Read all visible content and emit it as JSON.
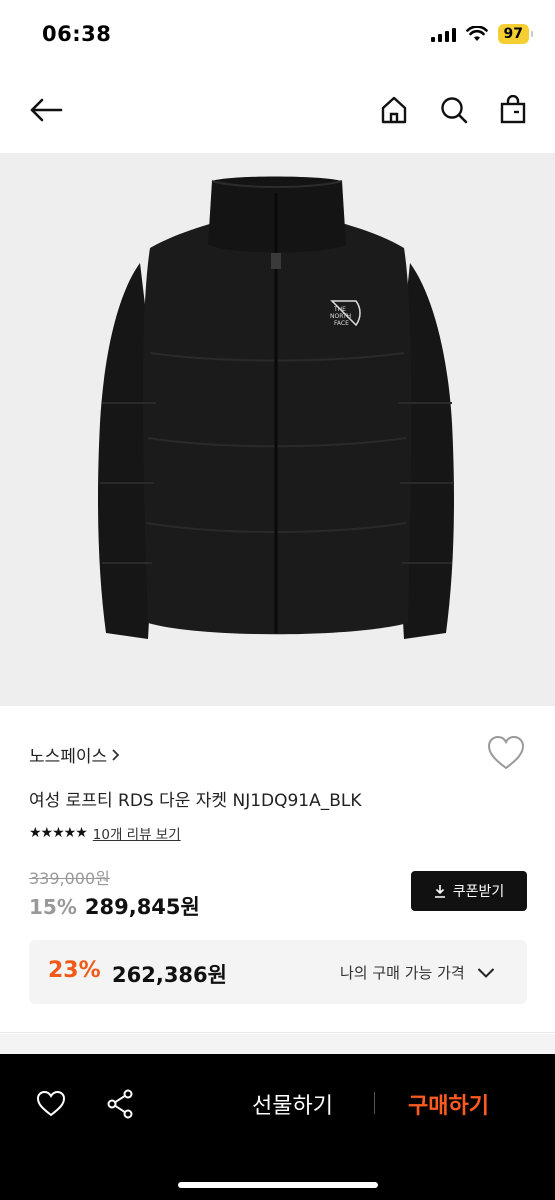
{
  "status_bar": {
    "time": "06:38",
    "battery": "97"
  },
  "header": {
    "back_icon": "arrow-left-icon",
    "home_icon": "home-icon",
    "search_icon": "search-icon",
    "cart_icon": "shopping-bag-icon"
  },
  "product": {
    "brand": "노스페이스",
    "name": "여성 로프티 RDS 다운 자켓 NJ1DQ91A_BLK",
    "rating_stars": "★★★★★",
    "review_link": "10개 리뷰 보기",
    "original_price": "339,000원",
    "discount_rate": "15%",
    "sale_price": "289,845원",
    "coupon_button": "쿠폰받기",
    "my_discount_rate": "23%",
    "my_price": "262,386원",
    "my_price_label": "나의 구매 가능 가격",
    "logo_text": "THE NORTH FACE"
  },
  "bottom_bar": {
    "gift_label": "선물하기",
    "buy_label": "구매하기"
  },
  "colors": {
    "accent": "#f05a18",
    "buy": "#ff5a1f",
    "battery": "#f5cf32"
  }
}
